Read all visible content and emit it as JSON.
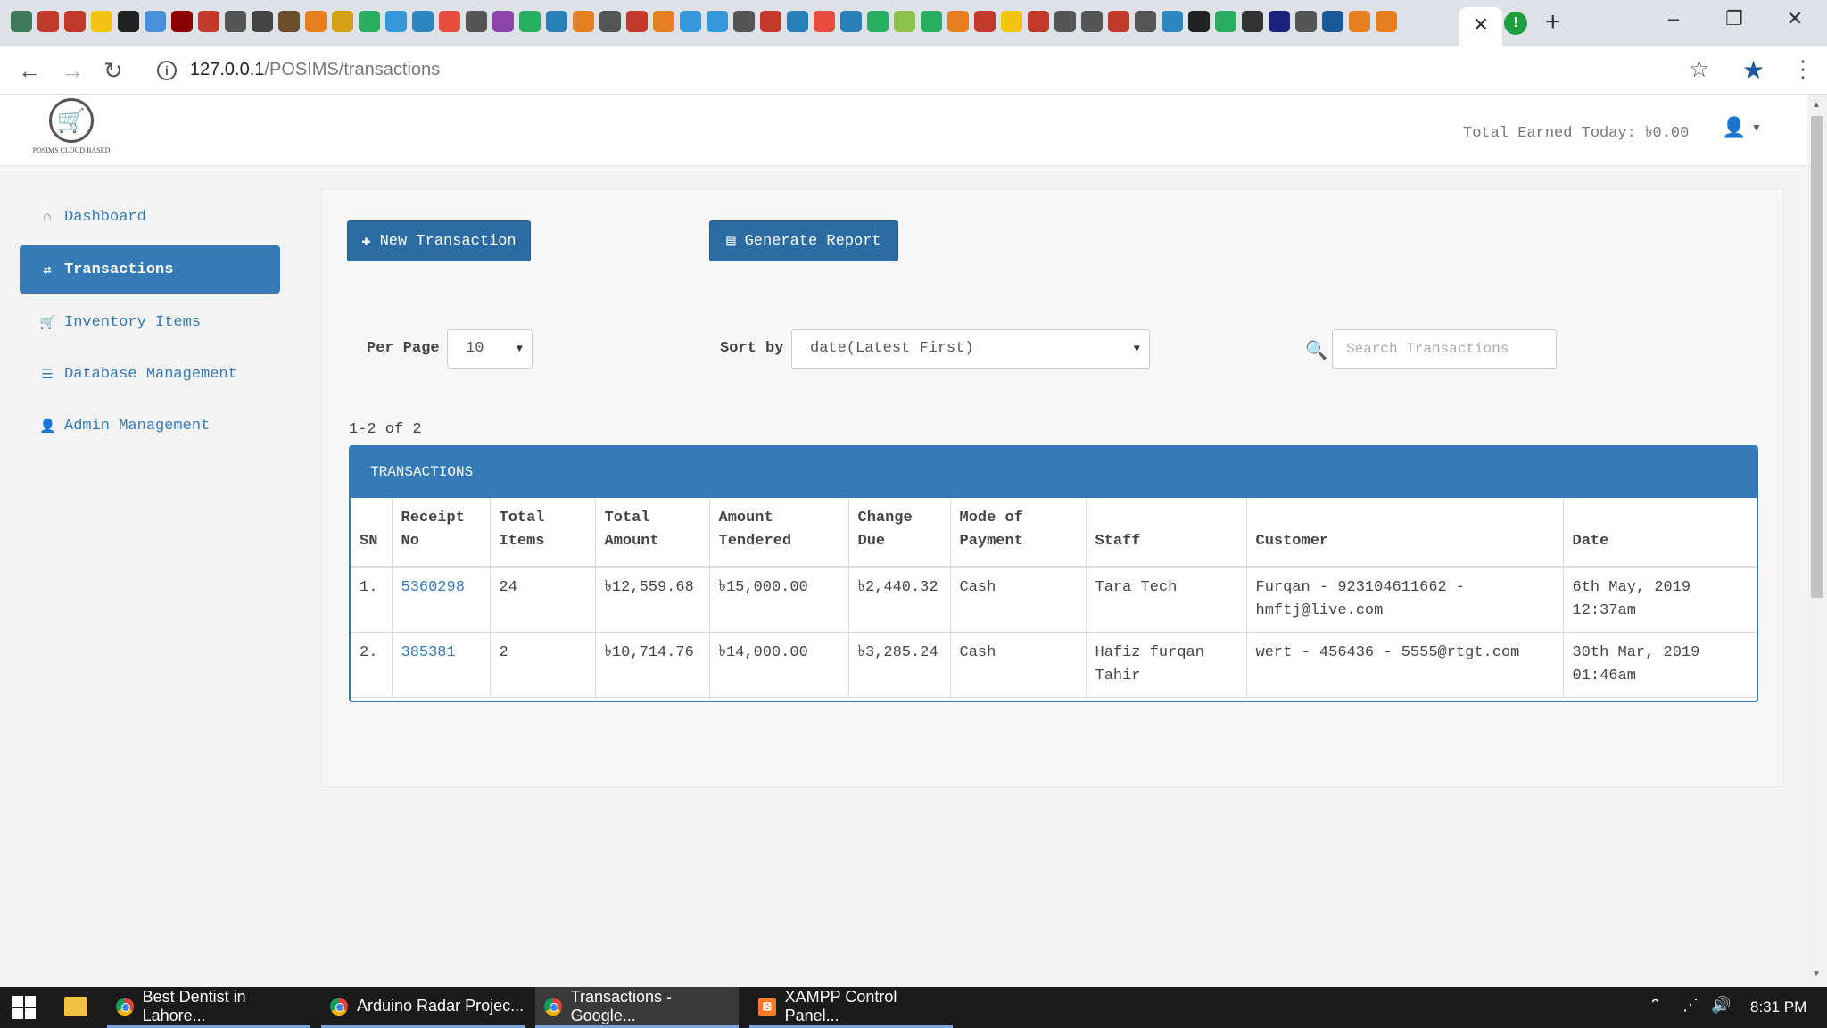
{
  "browser": {
    "tab_colors": [
      "#3d7a5c",
      "#c0392b",
      "#c0392b",
      "#f1c40f",
      "#222222",
      "#4a90d9",
      "#8b0000",
      "#c0392b",
      "#555555",
      "#444444",
      "#6b4f2a",
      "#e67e22",
      "#d4a017",
      "#27ae60",
      "#3498db",
      "#2e86c1",
      "#e74c3c",
      "#555555",
      "#8e44ad",
      "#27ae60",
      "#2980b9",
      "#e67e22",
      "#555555",
      "#c0392b",
      "#e67e22",
      "#3498db",
      "#3498db",
      "#555555",
      "#c0392b",
      "#2980b9",
      "#e74c3c",
      "#2980b9",
      "#27ae60",
      "#8bc34a",
      "#27ae60",
      "#e67e22",
      "#c0392b",
      "#f1c40f",
      "#c0392b",
      "#555555",
      "#555555",
      "#c0392b",
      "#555555",
      "#2e86c1",
      "#222222",
      "#27ae60",
      "#333333",
      "#1a237e",
      "#555555",
      "#1a5a9a",
      "#e67e22",
      "#e67e22"
    ],
    "active_tab_close": "✕",
    "new_tab": "+",
    "url_host": "127.0.0.1",
    "url_path": "/POSIMS/transactions"
  },
  "app": {
    "logo_text": "POSIMS CLOUD BASED",
    "total_earned": "Total Earned Today: ৳0.00"
  },
  "sidebar": {
    "items": [
      {
        "label": "Dashboard",
        "icon": "home-icon"
      },
      {
        "label": "Transactions",
        "icon": "exchange-icon"
      },
      {
        "label": "Inventory Items",
        "icon": "cart-icon"
      },
      {
        "label": "Database Management",
        "icon": "database-icon"
      },
      {
        "label": "Admin Management",
        "icon": "user-icon"
      }
    ]
  },
  "toolbar": {
    "new_transaction": "New Transaction",
    "generate_report": "Generate Report"
  },
  "controls": {
    "per_page_label": "Per Page",
    "per_page_value": "10",
    "sort_label": "Sort by",
    "sort_value": "date(Latest First)",
    "search_placeholder": "Search Transactions"
  },
  "table": {
    "count_text": "1-2 of 2",
    "title": "TRANSACTIONS",
    "headers": {
      "sn": "SN",
      "receipt": [
        "Receipt",
        "No"
      ],
      "total_items": [
        "Total",
        "Items"
      ],
      "total_amount": [
        "Total",
        "Amount"
      ],
      "amount_tendered": [
        "Amount",
        "Tendered"
      ],
      "change_due": [
        "Change",
        "Due"
      ],
      "mode": [
        "Mode of",
        "Payment"
      ],
      "staff": "Staff",
      "customer": "Customer",
      "date": "Date"
    },
    "rows": [
      {
        "sn": "1.",
        "receipt": "5360298",
        "total_items": "24",
        "total_amount": "৳12,559.68",
        "amount_tendered": "৳15,000.00",
        "change_due": "৳2,440.32",
        "mode": "Cash",
        "staff": "Tara Tech",
        "customer": "Furqan - 923104611662 - hmftj@live.com",
        "date": "6th May, 2019 12:37am"
      },
      {
        "sn": "2.",
        "receipt": "385381",
        "total_items": "2",
        "total_amount": "৳10,714.76",
        "amount_tendered": "৳14,000.00",
        "change_due": "৳3,285.24",
        "mode": "Cash",
        "staff": "Hafiz furqan Tahir",
        "customer": "wert - 456436 - 5555@rtgt.com",
        "date": "30th Mar, 2019 01:46am"
      }
    ]
  },
  "taskbar": {
    "items": [
      {
        "label": "Best Dentist in Lahore..."
      },
      {
        "label": "Arduino Radar Projec..."
      },
      {
        "label": "Transactions - Google..."
      },
      {
        "label": "XAMPP Control Panel..."
      }
    ],
    "time": "8:31 PM"
  }
}
